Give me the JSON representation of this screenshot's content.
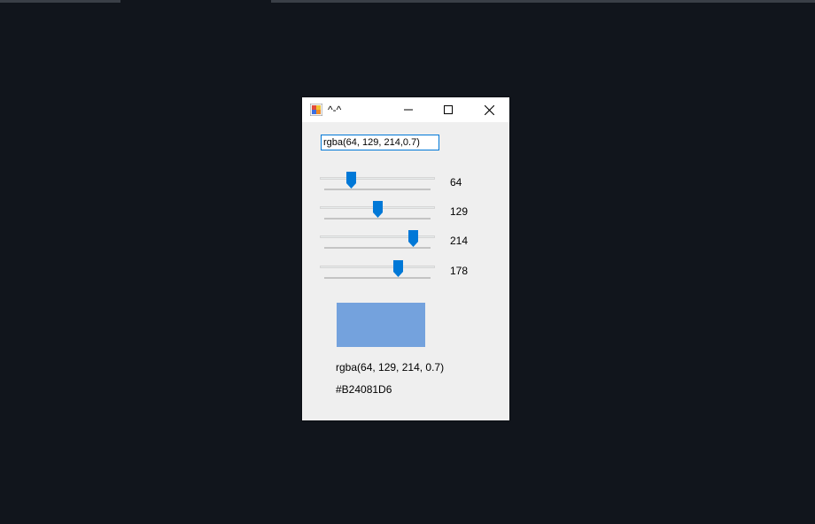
{
  "window": {
    "title": "^-^",
    "icons": {
      "app": "app-icon",
      "minimize": "minimize-icon",
      "maximize": "maximize-icon",
      "close": "close-icon"
    }
  },
  "input": {
    "value": "rgba(64, 129, 214,0.7)"
  },
  "sliders": [
    {
      "name": "red",
      "value": 64,
      "min": 0,
      "max": 255,
      "label": "64"
    },
    {
      "name": "green",
      "value": 129,
      "min": 0,
      "max": 255,
      "label": "129"
    },
    {
      "name": "blue",
      "value": 214,
      "min": 0,
      "max": 255,
      "label": "214"
    },
    {
      "name": "alpha",
      "value": 178,
      "min": 0,
      "max": 255,
      "label": "178"
    }
  ],
  "preview": {
    "color": "rgba(64, 129, 214, 0.7)"
  },
  "output": {
    "rgba_text": "rgba(64, 129, 214, 0.7)",
    "hex_text": "#B24081D6"
  },
  "colors": {
    "accent": "#0078d7",
    "desktop": "#11151c",
    "window_bg": "#efefef"
  }
}
